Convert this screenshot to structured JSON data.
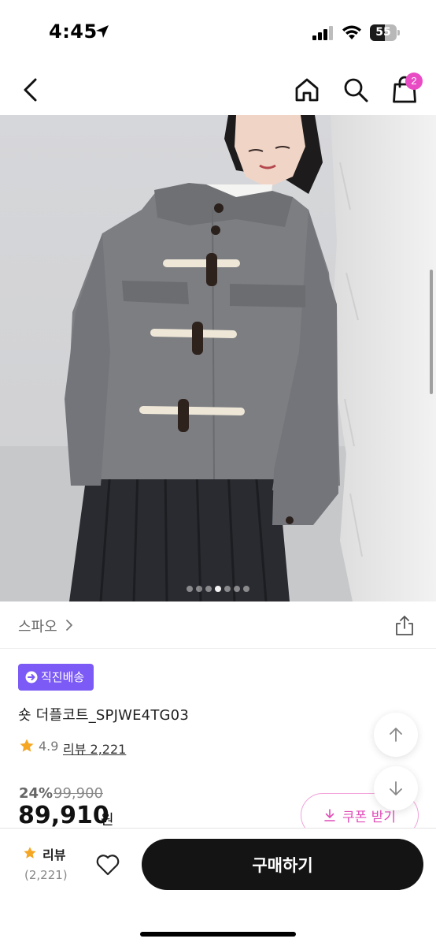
{
  "status_bar": {
    "time": "4:45",
    "battery": "55"
  },
  "nav": {
    "cart_count": "2",
    "icons": [
      "back-icon",
      "home-icon",
      "search-icon",
      "shopping-bag-icon"
    ]
  },
  "gallery": {
    "image_description": "product-photo",
    "total_slides": 7,
    "active_slide": 3
  },
  "brand": {
    "name": "스파오",
    "chevron": "›"
  },
  "product": {
    "badge": "직진배송",
    "title": "숏 더플코트_SPJWE4TG03",
    "rating": "4.9",
    "review_link": "리뷰 2,221",
    "discount": "24%",
    "original_price": "99,900",
    "price": "89,910",
    "price_unit": "원",
    "coupon_label": "쿠폰 받기"
  },
  "bottom_bar": {
    "review_label": "리뷰",
    "review_count": "(2,221)",
    "buy_label": "구매하기"
  },
  "colors": {
    "accent_pink": "#e94bc4",
    "badge_purple": "#7b5af5",
    "star": "#f5a623",
    "buy_button": "#141414"
  }
}
